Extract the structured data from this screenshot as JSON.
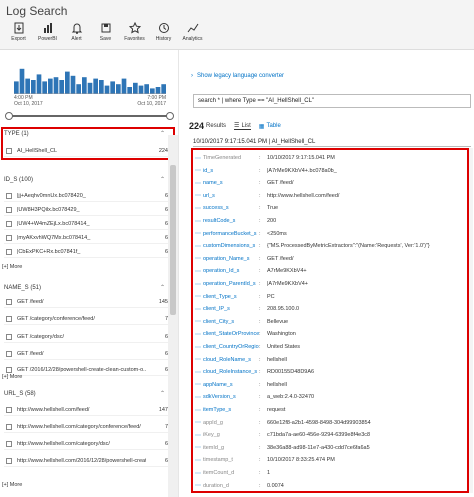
{
  "app": {
    "title": "Log Search"
  },
  "toolbar": [
    {
      "label": "Export",
      "icon": "export-icon"
    },
    {
      "label": "PowerBI",
      "icon": "powerbi-icon"
    },
    {
      "label": "Alert",
      "icon": "bell-icon"
    },
    {
      "label": "Save",
      "icon": "save-icon"
    },
    {
      "label": "Favorites",
      "icon": "star-icon"
    },
    {
      "label": "History",
      "icon": "history-icon"
    },
    {
      "label": "Analytics",
      "icon": "analytics-icon"
    }
  ],
  "timeline": {
    "bars": [
      0.45,
      0.9,
      0.55,
      0.5,
      0.7,
      0.45,
      0.55,
      0.6,
      0.5,
      0.8,
      0.65,
      0.35,
      0.6,
      0.4,
      0.55,
      0.5,
      0.3,
      0.45,
      0.35,
      0.55,
      0.25,
      0.4,
      0.3,
      0.35,
      0.2,
      0.25,
      0.35
    ],
    "start_time": "4:00 PM",
    "start_date": "Oct 10, 2017",
    "end_time": "7:00 PM",
    "end_date": "Oct 10, 2017"
  },
  "facets": {
    "type": {
      "title": "TYPE (1)",
      "rows": [
        {
          "value": "AI_HellShell_CL",
          "count": "224"
        }
      ]
    },
    "id": {
      "title": "ID_S (100)",
      "rows": [
        {
          "value": "|jj+Aeqhv0mnUx.bc078420_",
          "count": "6"
        },
        {
          "value": "|UW8H3PQilx.bc078429_",
          "count": "6"
        },
        {
          "value": "|UW4+W4mZEjLx.bc078414_",
          "count": "6"
        },
        {
          "value": "|myAKxvhWQ7Mx.bc078414_",
          "count": "6"
        },
        {
          "value": "|CbExPKC+Rx.bc07841f_",
          "count": "6"
        }
      ]
    },
    "name": {
      "title": "NAME_S (51)",
      "rows": [
        {
          "value": "GET /feed/",
          "count": "145"
        },
        {
          "value": "GET /category/conference/feed/",
          "count": "7"
        },
        {
          "value": "GET /category/dsc/",
          "count": "6"
        },
        {
          "value": "GET /feed/",
          "count": "6"
        },
        {
          "value": "GET /2016/12/28/powershell-create-clean-custom-o...",
          "count": "6"
        }
      ]
    },
    "url": {
      "title": "URL_S (58)",
      "rows": [
        {
          "value": "http://www.hellshell.com/feed/",
          "count": "147"
        },
        {
          "value": "http://www.hellshell.com/category/conference/feed/",
          "count": "7"
        },
        {
          "value": "http://www.hellshell.com/category/dsc/",
          "count": "6"
        },
        {
          "value": "http://www.hellshell.com/2016/12/28/powershell-create-cl...",
          "count": "6"
        }
      ]
    },
    "more_label": "[+] More",
    "collapse_glyph": "⌃"
  },
  "right": {
    "legacy_label": "Show legacy language converter",
    "query": "search * | where Type == \"AI_HellShell_CL\"",
    "results_count": "224",
    "results_label": "Results",
    "tabs": [
      {
        "label": "List"
      },
      {
        "label": "Table"
      }
    ],
    "record_header": "10/10/2017 9:17:15.041 PM | AI_HellShell_CL",
    "fields": [
      {
        "k": "TimeGenerated",
        "v": "10/10/2017 9:17:15.041 PM",
        "grey": true
      },
      {
        "k": "id_s",
        "v": "|A7rMe9KXbV4+.bc078a0b_",
        "grey": false
      },
      {
        "k": "name_s",
        "v": "GET /feed/",
        "grey": false
      },
      {
        "k": "url_s",
        "v": "http://www.hellshell.com/feed/",
        "grey": false
      },
      {
        "k": "success_s",
        "v": "True",
        "grey": false
      },
      {
        "k": "resultCode_s",
        "v": "200",
        "grey": false
      },
      {
        "k": "performanceBucket_s",
        "v": "<250ms",
        "grey": false
      },
      {
        "k": "customDimensions_s",
        "v": "{\"MS.ProcessedByMetricExtractors\":\"(Name:'Requests', Ver:'1.0')\"}",
        "grey": false
      },
      {
        "k": "operation_Name_s",
        "v": "GET /feed/",
        "grey": false
      },
      {
        "k": "operation_Id_s",
        "v": "A7rMe9KXbV4+",
        "grey": false
      },
      {
        "k": "operation_ParentId_s",
        "v": "|A7rMe9KXbV4+",
        "grey": false
      },
      {
        "k": "client_Type_s",
        "v": "PC",
        "grey": false
      },
      {
        "k": "client_IP_s",
        "v": "208.95.100.0",
        "grey": false
      },
      {
        "k": "client_City_s",
        "v": "Bellevue",
        "grey": false
      },
      {
        "k": "client_StateOrProvince_s",
        "v": "Washington",
        "grey": false
      },
      {
        "k": "client_CountryOrRegion_s",
        "v": "United States",
        "grey": false
      },
      {
        "k": "cloud_RoleName_s",
        "v": "hellshell",
        "grey": false
      },
      {
        "k": "cloud_RoleInstance_s",
        "v": "RD00155D48D9A6",
        "grey": false
      },
      {
        "k": "appName_s",
        "v": "hellshell",
        "grey": false
      },
      {
        "k": "sdkVersion_s",
        "v": "a_web:2.4.0-32470",
        "grey": false
      },
      {
        "k": "itemType_s",
        "v": "request",
        "grey": false
      },
      {
        "k": "appId_g",
        "v": "660e12f8-a2b1-4598-8498-304d99903854",
        "grey": true
      },
      {
        "k": "iKey_g",
        "v": "c71bda7a-ae60-456e-9294-6399e8f4e3c8",
        "grey": true
      },
      {
        "k": "itemId_g",
        "v": "38e36a88-ad98-11e7-a430-cdd7ce6fa6a5",
        "grey": true
      },
      {
        "k": "timestamp_t",
        "v": "10/10/2017 8:33:25.474 PM",
        "grey": true
      },
      {
        "k": "itemCount_d",
        "v": "1",
        "grey": true
      },
      {
        "k": "duration_d",
        "v": "0.0074",
        "grey": true
      }
    ]
  },
  "colors": {
    "accent": "#0072c6",
    "highlight": "#d00000",
    "bar": "#2e75b6"
  }
}
